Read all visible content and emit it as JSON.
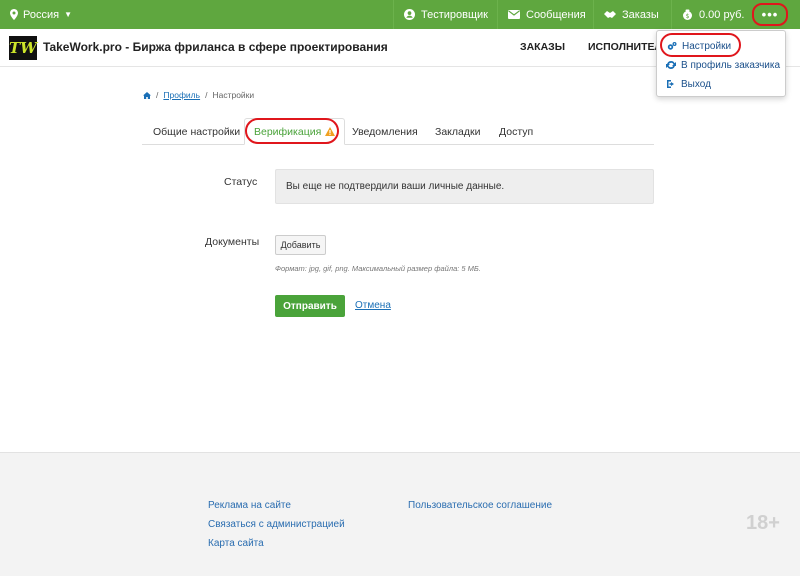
{
  "topbar": {
    "region": "Россия",
    "user": "Тестировщик",
    "messages": "Сообщения",
    "orders": "Заказы",
    "balance": "0.00 руб.",
    "more": "•••"
  },
  "header": {
    "logo": "TW",
    "title": "TakeWork.pro - Биржа фриланса в сфере проектирования",
    "nav_orders": "ЗАКАЗЫ",
    "nav_performers": "ИСПОЛНИТЕЛИ"
  },
  "dropdown": {
    "items": [
      {
        "label": "Настройки",
        "icon": "gears-icon"
      },
      {
        "label": "В профиль заказчика",
        "icon": "refresh-icon"
      },
      {
        "label": "Выход",
        "icon": "logout-icon"
      }
    ]
  },
  "breadcrumb": {
    "profile": "Профиль",
    "current": "Настройки"
  },
  "tabs": [
    {
      "label": "Общие настройки"
    },
    {
      "label": "Верификация",
      "active": true
    },
    {
      "label": "Уведомления"
    },
    {
      "label": "Закладки"
    },
    {
      "label": "Доступ"
    }
  ],
  "form": {
    "status_label": "Статус",
    "status_text": "Вы еще не подтвердили ваши личные данные.",
    "documents_label": "Документы",
    "add_button": "Добавить",
    "hint": "Формат: jpg, gif, png. Максимальный размер файла: 5 МБ.",
    "submit": "Отправить",
    "cancel": "Отмена"
  },
  "footer": {
    "ads": "Реклама на сайте",
    "contact": "Связаться с администрацией",
    "sitemap": "Карта сайта",
    "agreement": "Пользовательское соглашение",
    "age": "18+"
  },
  "colors": {
    "brand_green": "#5fa73f",
    "highlight_red": "#e0161c",
    "link_blue": "#1a6fb6"
  }
}
